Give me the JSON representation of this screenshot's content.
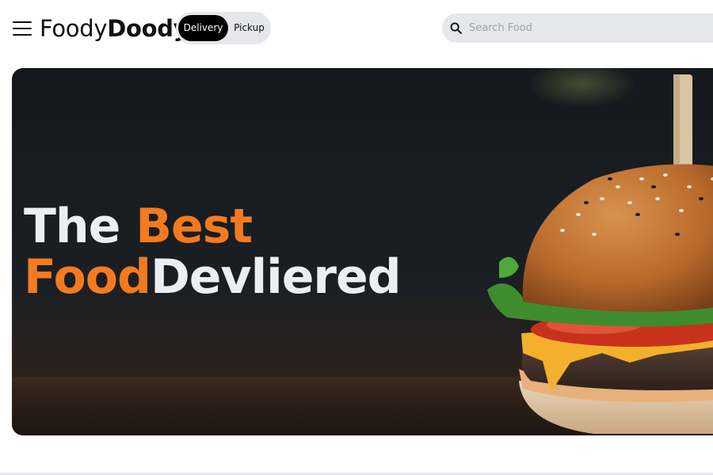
{
  "header": {
    "logo_light": "Foody",
    "logo_bold": "Doody",
    "toggle": {
      "delivery_label": "Delivery",
      "pickup_label": "Pickup",
      "selected": "Delivery"
    },
    "search": {
      "placeholder": "Search Food",
      "value": ""
    }
  },
  "hero": {
    "headline_line1_white": "The ",
    "headline_line1_orange": "Best",
    "headline_line2_orange": "Food",
    "headline_line2_white": "Devliered",
    "image_subject": "burger"
  },
  "icons": {
    "menu": "hamburger-menu-icon",
    "search": "search-icon"
  },
  "colors": {
    "accent": "#f47a20",
    "headline_white": "#eceef2",
    "toggle_bg": "#e5e7eb",
    "toggle_active": "#000000",
    "hero_bg": "#15191d"
  }
}
